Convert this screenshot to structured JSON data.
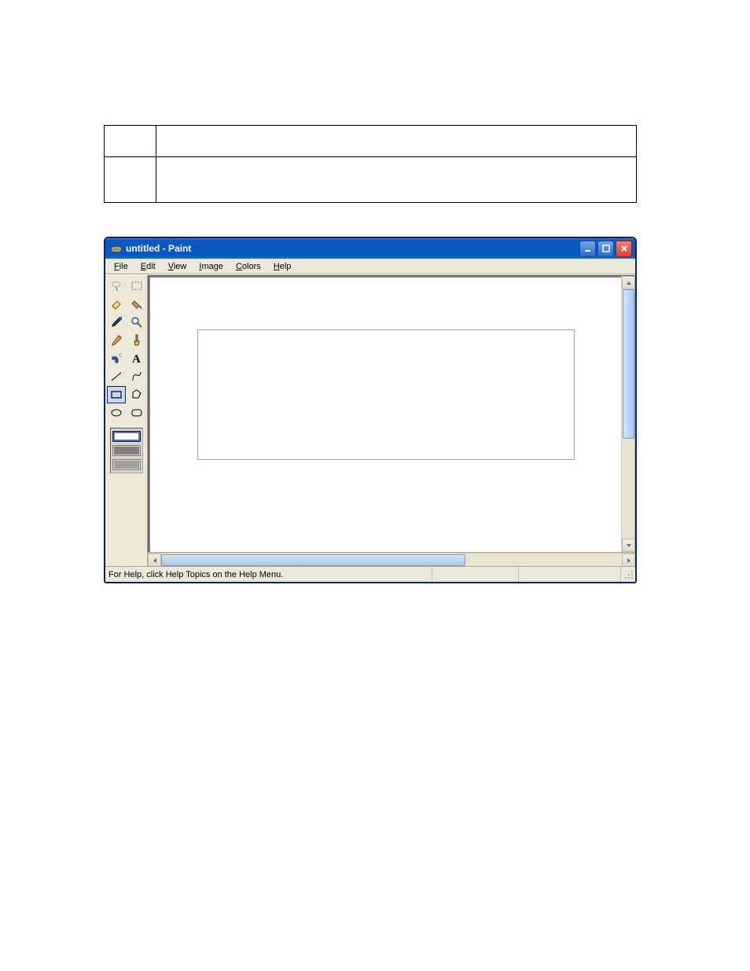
{
  "window": {
    "title": "untitled - Paint"
  },
  "menu": {
    "file": "File",
    "edit": "Edit",
    "view": "View",
    "image": "Image",
    "colors": "Colors",
    "help": "Help"
  },
  "tools": {
    "free_form_select": "Free-Form Select",
    "select": "Select",
    "eraser": "Eraser",
    "fill": "Fill With Color",
    "pick_color": "Pick Color",
    "magnifier": "Magnifier",
    "pencil": "Pencil",
    "brush": "Brush",
    "airbrush": "Airbrush",
    "text": "Text",
    "line": "Line",
    "curve": "Curve",
    "rectangle": "Rectangle",
    "polygon": "Polygon",
    "ellipse": "Ellipse",
    "rounded_rectangle": "Rounded Rectangle"
  },
  "status": {
    "help_text": "For Help, click Help Topics on the Help Menu.",
    "coords": "",
    "size": ""
  }
}
